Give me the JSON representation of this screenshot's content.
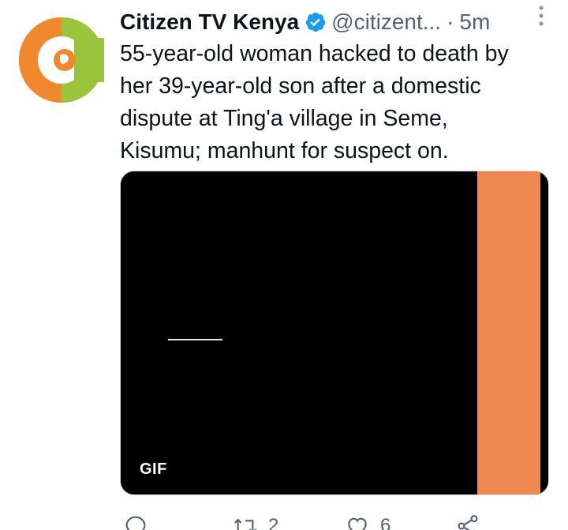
{
  "account": {
    "display_name": "Citizen TV Kenya",
    "handle": "@citizent...",
    "separator": "·",
    "time": "5m",
    "verified": true,
    "avatar_icon": "citizen-tv-logo",
    "avatar_colors": {
      "orange": "#f0892e",
      "green": "#9ac43c"
    }
  },
  "tweet": {
    "text": "55-year-old woman hacked to death by\nher 39-year-old son after a domestic\ndispute at Ting'a village in Seme,\nKisumu; manhunt for suspect on."
  },
  "media": {
    "badge": "GIF",
    "colors": {
      "left": "#000000",
      "right": "#f0894f"
    }
  },
  "actions": {
    "reply": {
      "icon": "reply-icon",
      "count": ""
    },
    "retweet": {
      "icon": "retweet-icon",
      "count": "2"
    },
    "like": {
      "icon": "heart-icon",
      "count": "6"
    },
    "share": {
      "icon": "share-icon",
      "count": ""
    }
  },
  "colors": {
    "verified": "#1d9bf0",
    "secondary_text": "#536471",
    "primary_text": "#0f1419"
  }
}
